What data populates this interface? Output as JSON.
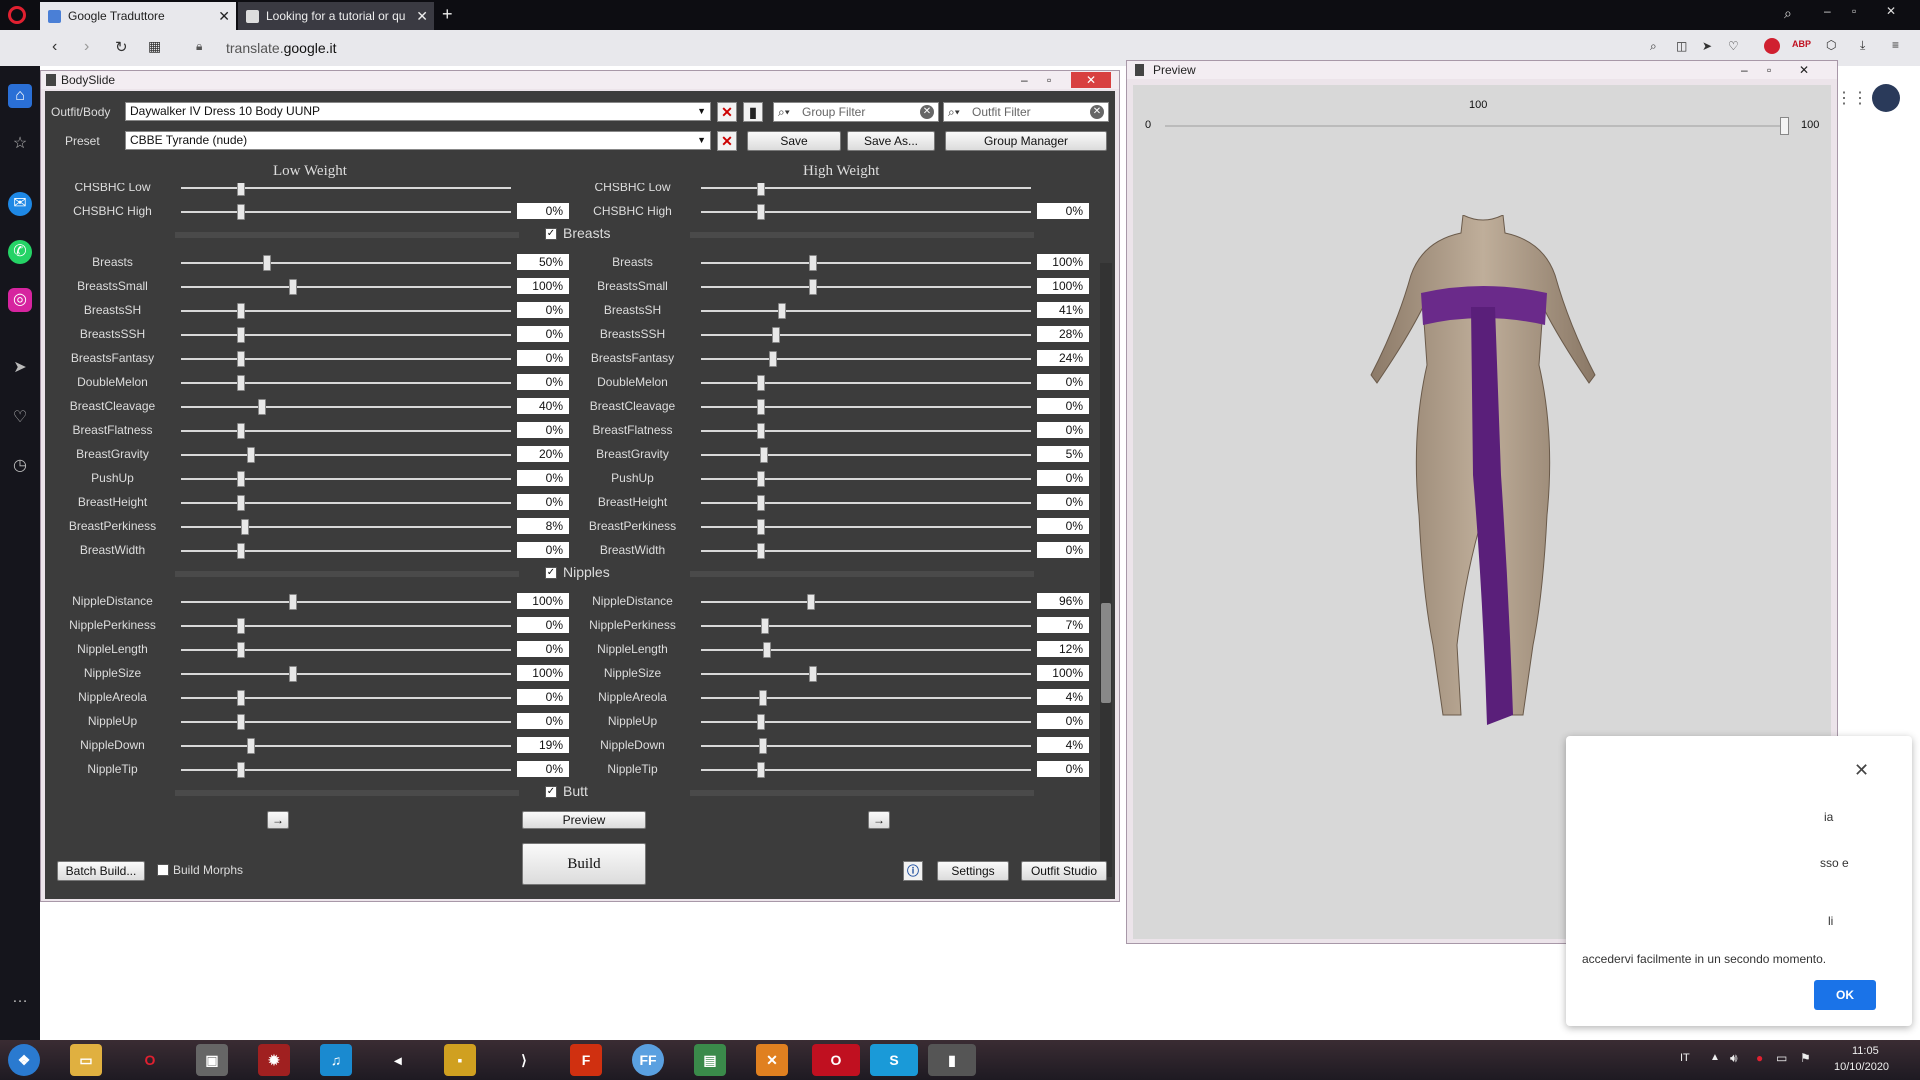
{
  "browser": {
    "tabs": [
      {
        "title": "Google Traduttore",
        "active": true
      },
      {
        "title": "Looking for a tutorial or qu",
        "active": false
      }
    ],
    "url_prefix": "translate.",
    "url_domain": "google.it"
  },
  "bodyslide": {
    "title": "BodySlide",
    "outfit_label": "Outfit/Body",
    "outfit_value": "Daywalker IV Dress 10 Body UUNP",
    "preset_label": "Preset",
    "preset_value": "CBBE Tyrande (nude)",
    "group_filter": "Group Filter",
    "outfit_filter": "Outfit Filter",
    "save": "Save",
    "save_as": "Save As...",
    "group_manager": "Group Manager",
    "low_weight": "Low Weight",
    "high_weight": "High Weight",
    "partial_row": "CHSBHC Low",
    "top_row": {
      "name": "CHSBHC High",
      "low": "0%",
      "high": "0%",
      "lowv": 0,
      "highv": 0
    },
    "groups": [
      {
        "name": "Breasts",
        "sliders": [
          {
            "name": "Breasts",
            "low": "50%",
            "high": "100%",
            "lowv": 50,
            "highv": 100
          },
          {
            "name": "BreastsSmall",
            "low": "100%",
            "high": "100%",
            "lowv": 100,
            "highv": 100
          },
          {
            "name": "BreastsSH",
            "low": "0%",
            "high": "41%",
            "lowv": 0,
            "highv": 41
          },
          {
            "name": "BreastsSSH",
            "low": "0%",
            "high": "28%",
            "lowv": 0,
            "highv": 28
          },
          {
            "name": "BreastsFantasy",
            "low": "0%",
            "high": "24%",
            "lowv": 0,
            "highv": 24
          },
          {
            "name": "DoubleMelon",
            "low": "0%",
            "high": "0%",
            "lowv": 0,
            "highv": 0
          },
          {
            "name": "BreastCleavage",
            "low": "40%",
            "high": "0%",
            "lowv": 40,
            "highv": 0
          },
          {
            "name": "BreastFlatness",
            "low": "0%",
            "high": "0%",
            "lowv": 0,
            "highv": 0
          },
          {
            "name": "BreastGravity",
            "low": "20%",
            "high": "5%",
            "lowv": 20,
            "highv": 5
          },
          {
            "name": "PushUp",
            "low": "0%",
            "high": "0%",
            "lowv": 0,
            "highv": 0
          },
          {
            "name": "BreastHeight",
            "low": "0%",
            "high": "0%",
            "lowv": 0,
            "highv": 0
          },
          {
            "name": "BreastPerkiness",
            "low": "8%",
            "high": "0%",
            "lowv": 8,
            "highv": 0
          },
          {
            "name": "BreastWidth",
            "low": "0%",
            "high": "0%",
            "lowv": 0,
            "highv": 0
          }
        ]
      },
      {
        "name": "Nipples",
        "sliders": [
          {
            "name": "NippleDistance",
            "low": "100%",
            "high": "96%",
            "lowv": 100,
            "highv": 96
          },
          {
            "name": "NipplePerkiness",
            "low": "0%",
            "high": "7%",
            "lowv": 0,
            "highv": 7
          },
          {
            "name": "NippleLength",
            "low": "0%",
            "high": "12%",
            "lowv": 0,
            "highv": 12
          },
          {
            "name": "NippleSize",
            "low": "100%",
            "high": "100%",
            "lowv": 100,
            "highv": 100
          },
          {
            "name": "NippleAreola",
            "low": "0%",
            "high": "4%",
            "lowv": 0,
            "highv": 4
          },
          {
            "name": "NippleUp",
            "low": "0%",
            "high": "0%",
            "lowv": 0,
            "highv": 0
          },
          {
            "name": "NippleDown",
            "low": "19%",
            "high": "4%",
            "lowv": 19,
            "highv": 4
          },
          {
            "name": "NippleTip",
            "low": "0%",
            "high": "0%",
            "lowv": 0,
            "highv": 0
          }
        ]
      },
      {
        "name": "Butt",
        "sliders": []
      }
    ],
    "preview": "Preview",
    "build": "Build",
    "batch_build": "Batch Build...",
    "build_morphs": "Build Morphs",
    "settings": "Settings",
    "outfit_studio": "Outfit Studio",
    "arrow": "→"
  },
  "preview_window": {
    "title": "Preview",
    "weight_top": "100",
    "min": "0",
    "max": "100",
    "weight": 100
  },
  "toast": {
    "text": "accedervi facilmente in un secondo momento.",
    "ok": "OK",
    "frag1": "ia",
    "frag2": "sso e",
    "frag3": "li"
  },
  "taskbar": {
    "lang": "IT",
    "time": "11:05",
    "date": "10/10/2020"
  },
  "colors": {
    "accent": "#c01020",
    "purple": "#6a2a8a"
  }
}
